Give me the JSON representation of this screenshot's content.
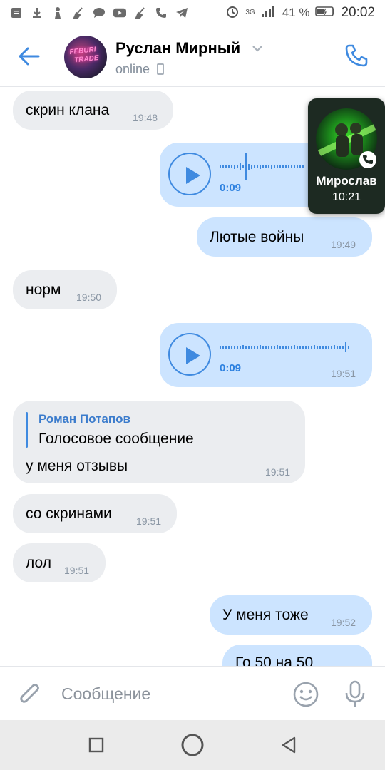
{
  "status_bar": {
    "icons_left": [
      "message-icon",
      "download-icon",
      "vk-icon",
      "cleaner-icon",
      "chat-icon",
      "youtube-icon",
      "cleaner-icon",
      "phone-icon",
      "telegram-icon"
    ],
    "network": "3G",
    "battery_percent": "41 %",
    "time": "20:02"
  },
  "header": {
    "contact_name": "Руслан Мирный",
    "status": "online",
    "avatar_text": "FEBURI\nTRADE"
  },
  "messages": [
    {
      "dir": "in",
      "type": "text",
      "text": "скрин клана",
      "time": "19:48"
    },
    {
      "dir": "out",
      "type": "voice",
      "duration": "0:09",
      "time": ""
    },
    {
      "dir": "out",
      "type": "text",
      "text": "Лютые войны",
      "time": "19:49"
    },
    {
      "dir": "in",
      "type": "text",
      "text": "норм",
      "time": "19:50"
    },
    {
      "dir": "out",
      "type": "voice",
      "duration": "0:09",
      "time": "19:51"
    },
    {
      "dir": "in",
      "type": "reply",
      "reply_author": "Роман Потапов",
      "reply_text": "Голосовое сообщение",
      "text": "у меня отзывы",
      "time": "19:51"
    },
    {
      "dir": "in",
      "type": "text",
      "text": "со скринами",
      "time": "19:51"
    },
    {
      "dir": "in",
      "type": "text",
      "text": "лол",
      "time": "19:51"
    },
    {
      "dir": "out",
      "type": "text",
      "text": "У меня тоже",
      "time": "19:52"
    },
    {
      "dir": "out",
      "type": "text",
      "text": "Го 50 на 50",
      "time": ""
    }
  ],
  "call_overlay": {
    "name": "Мирослав",
    "duration": "10:21"
  },
  "composer": {
    "placeholder": "Сообщение"
  },
  "colors": {
    "accent": "#3f8ae0",
    "incoming_bubble": "#ebedf0",
    "outgoing_bubble": "#cce4ff"
  }
}
